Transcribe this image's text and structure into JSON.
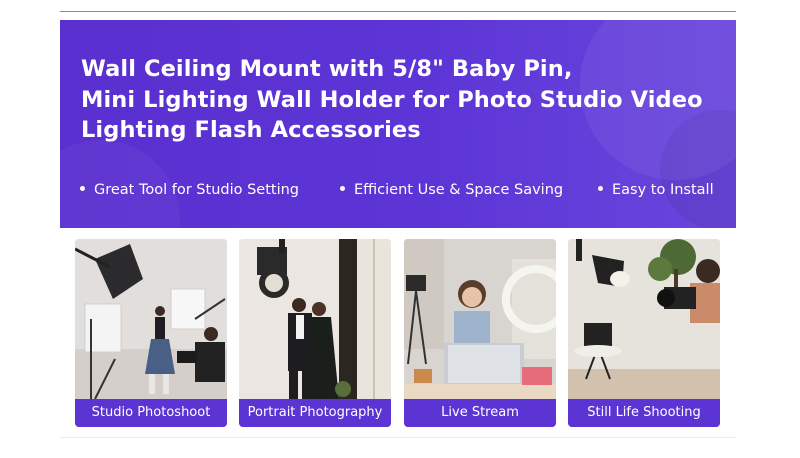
{
  "banner": {
    "title_lines": [
      "Wall Ceiling Mount with 5/8\" Baby Pin,",
      "Mini Lighting Wall Holder for Photo Studio Video",
      "Lighting Flash Accessories"
    ],
    "features": [
      "Great Tool for Studio Setting",
      "Efficient Use & Space Saving",
      "Easy to Install"
    ]
  },
  "cards": [
    {
      "caption": "Studio Photoshoot"
    },
    {
      "caption": "Portrait Photography"
    },
    {
      "caption": "Live Stream"
    },
    {
      "caption": "Still Life Shooting"
    }
  ],
  "colors": {
    "banner_purple": "#5a2fcf",
    "caption_purple": "#5c34d4",
    "text": "#ffffff"
  }
}
